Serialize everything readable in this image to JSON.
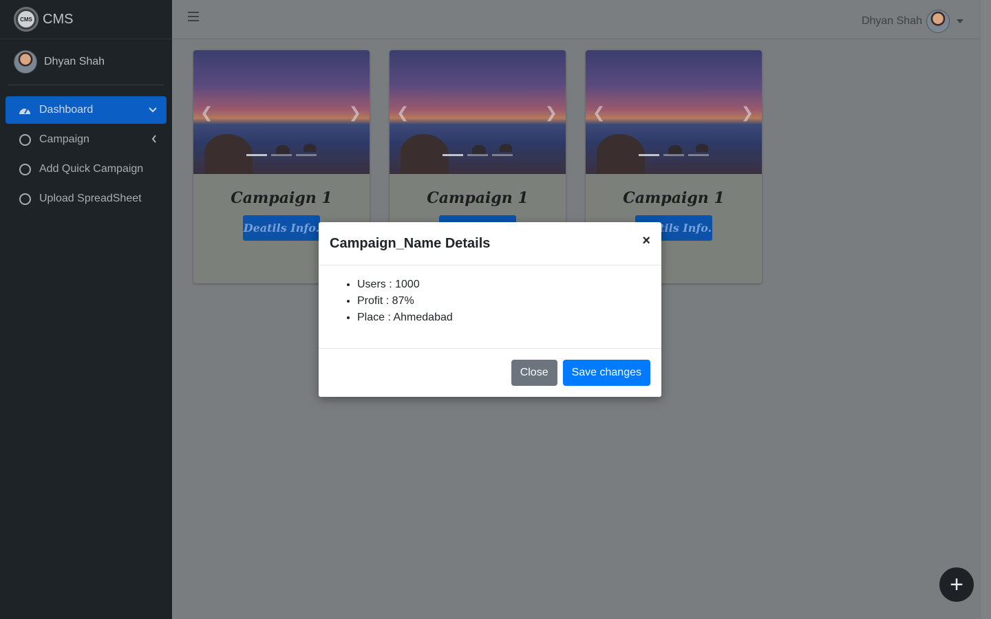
{
  "brand": {
    "logo_text": "CMS",
    "name": "CMS"
  },
  "sidebar": {
    "user_name": "Dhyan Shah",
    "items": [
      {
        "label": "Dashboard",
        "icon": "dashboard-icon",
        "active": true
      },
      {
        "label": "Campaign",
        "icon": "circle-icon"
      },
      {
        "label": "Add Quick Campaign",
        "icon": "circle-icon"
      },
      {
        "label": "Upload SpreadSheet",
        "icon": "circle-icon"
      }
    ]
  },
  "header": {
    "user_name": "Dhyan Shah"
  },
  "cards": [
    {
      "title": "Campaign 1",
      "button": "Deatils Info."
    },
    {
      "title": "Campaign 1",
      "button": "Deatils Info."
    },
    {
      "title": "Campaign 1",
      "button": "Deatils Info."
    }
  ],
  "modal": {
    "title": "Campaign_Name Details",
    "close_symbol": "×",
    "details": [
      "Users : 1000",
      "Profit : 87%",
      "Place : Ahmedabad"
    ],
    "close_label": "Close",
    "save_label": "Save changes"
  },
  "fab": {
    "symbol": "+"
  },
  "colors": {
    "accent": "#007bff",
    "sidebar_active": "#0a5ec4",
    "sidebar_bg": "#1e2327"
  }
}
